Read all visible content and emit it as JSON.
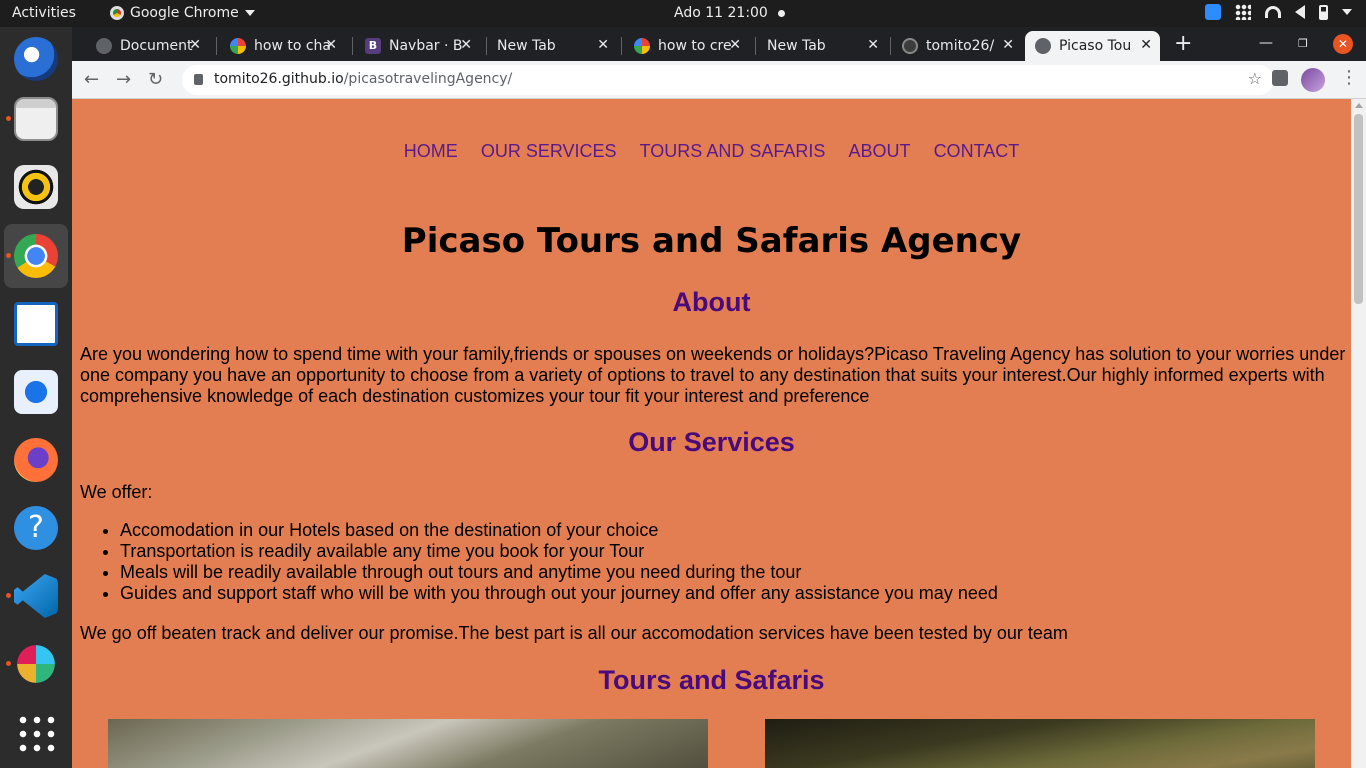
{
  "system": {
    "activities": "Activities",
    "app_name": "Google Chrome",
    "clock": "Ado 11  21:00"
  },
  "chrome": {
    "tabs": [
      {
        "title": "Document",
        "favicon": "globe-icon"
      },
      {
        "title": "how to cha",
        "favicon": "google-icon"
      },
      {
        "title": "Navbar · B",
        "favicon": "bootstrap-icon"
      },
      {
        "title": "New Tab",
        "favicon": "none"
      },
      {
        "title": "how to cre",
        "favicon": "google-icon"
      },
      {
        "title": "New Tab",
        "favicon": "none"
      },
      {
        "title": "tomito26/",
        "favicon": "github-icon"
      },
      {
        "title": "Picaso Tou",
        "favicon": "globe-icon",
        "active": true
      }
    ],
    "url_host": "tomito26.github.io",
    "url_path": "/picasotravelingAgency/"
  },
  "site": {
    "nav": [
      "HOME",
      "OUR SERVICES",
      "TOURS AND SAFARIS",
      "ABOUT",
      "CONTACT"
    ],
    "title": "Picaso Tours and Safaris Agency",
    "about_heading": "About",
    "about_text": "Are you wondering how to spend time with your family,friends or spouses on weekends or holidays?Picaso Traveling Agency has solution to your worries under one company you have an opportunity to choose from a variety of options to travel to any destination that suits your interest.Our highly informed experts with comprehensive knowledge of each destination customizes your tour fit your interest and preference",
    "services_heading": "Our Services",
    "services_intro": "We offer:",
    "services": [
      "Accomodation in our Hotels based on the destination of your choice",
      "Transportation is readily available any time you book for your Tour",
      "Meals will be readily available through out tours and anytime you need during the tour",
      "Guides and support staff who will be with you through out your journey and offer any assistance you may need"
    ],
    "services_outro": "We go off beaten track and deliver our promise.The best part is all our accomodation services have been tested by our team",
    "tours_heading": "Tours and Safaris"
  },
  "colors": {
    "page_bg": "#e37e53",
    "nav_link": "#5a1a8c",
    "heading": "#4a0a7c",
    "ubuntu_accent": "#e95420"
  }
}
